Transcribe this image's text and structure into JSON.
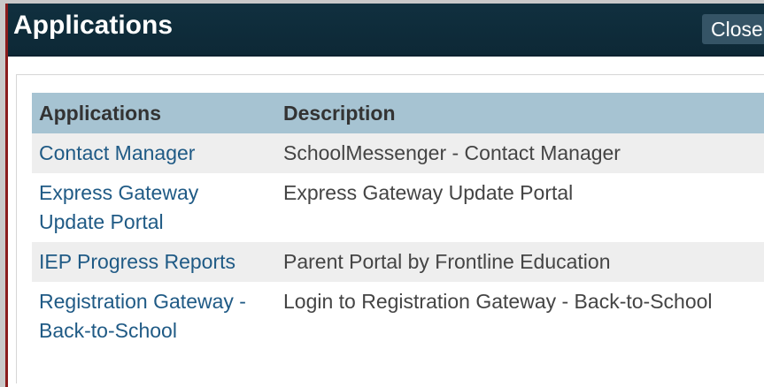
{
  "window": {
    "title": "Applications",
    "close_label": "Close"
  },
  "table": {
    "headers": {
      "applications": "Applications",
      "description": "Description"
    },
    "rows": [
      {
        "application_line1": "Contact Manager",
        "application_line2": "",
        "description": "SchoolMessenger - Contact Manager"
      },
      {
        "application_line1": "Express Gateway",
        "application_line2": "Update Portal",
        "description": "Express Gateway Update Portal"
      },
      {
        "application_line1": "IEP Progress Reports",
        "application_line2": "",
        "description": "Parent Portal by Frontline Education"
      },
      {
        "application_line1": "Registration Gateway -",
        "application_line2": "Back-to-School",
        "description": "Login to Registration Gateway - Back-to-School"
      }
    ]
  },
  "colors": {
    "titlebar": "#10303f",
    "header_row": "#a6c3d2",
    "link": "#1f5a85",
    "alt_row": "#eeeeee"
  }
}
